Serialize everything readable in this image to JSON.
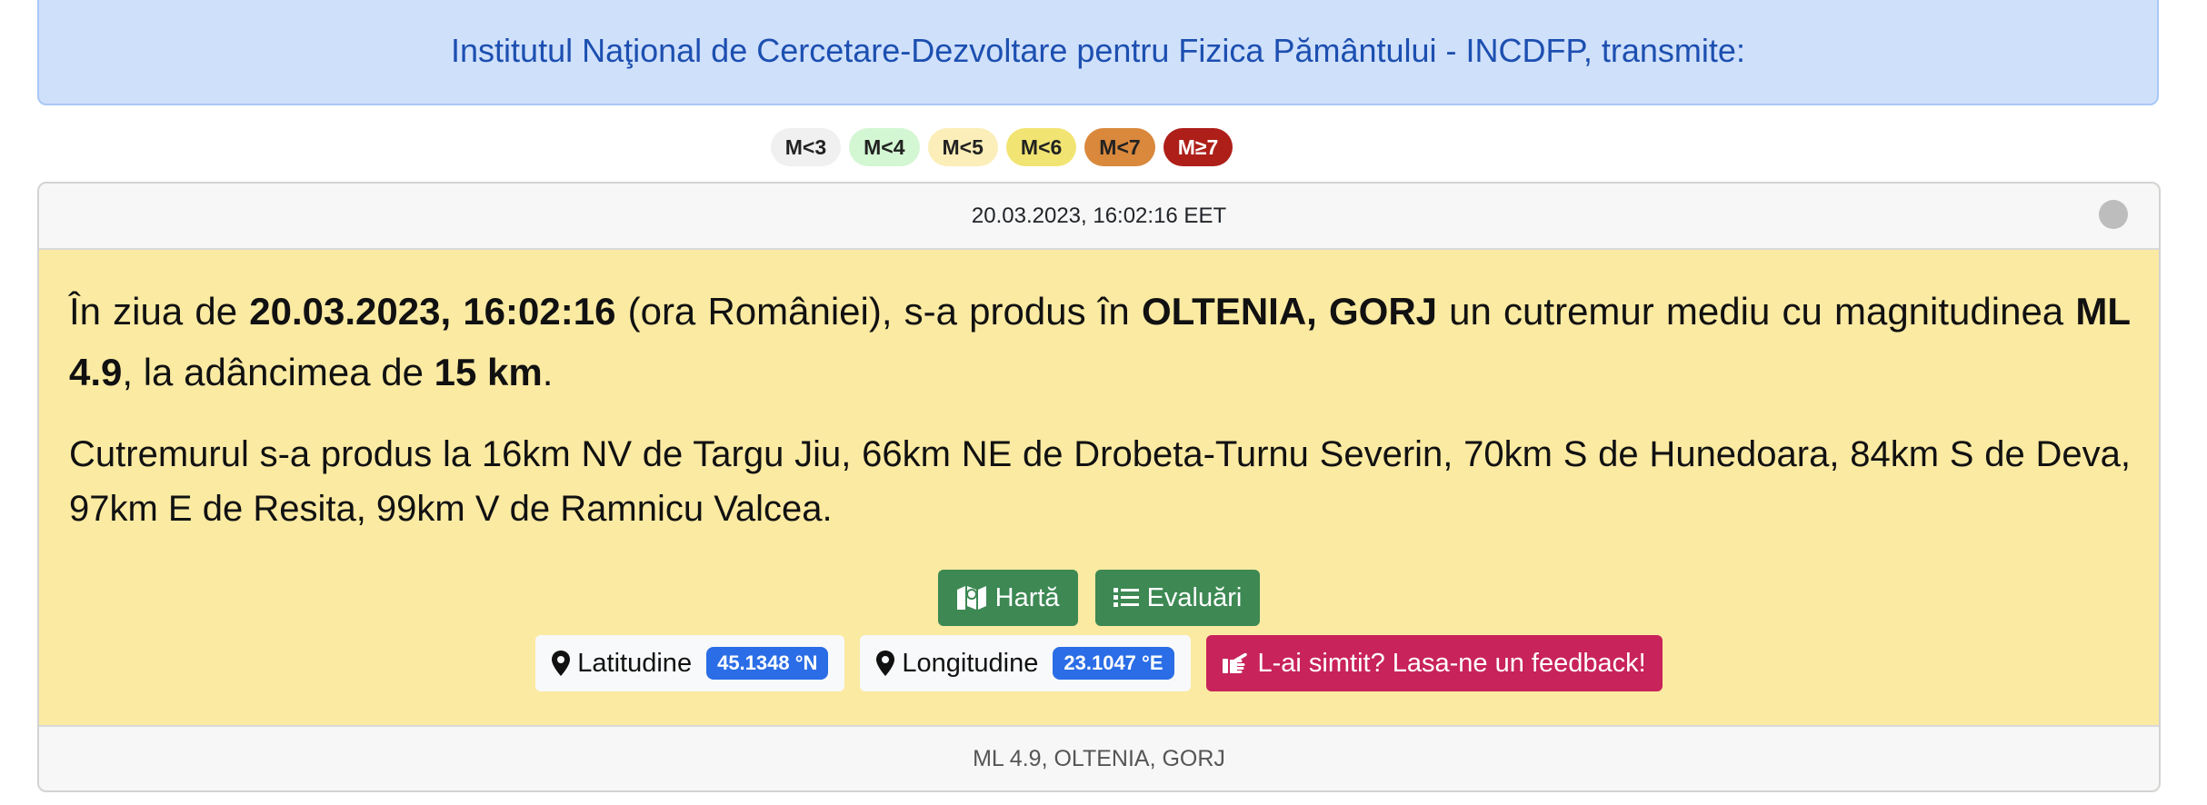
{
  "banner": {
    "text": "Institutul Naţional de Cercetare-Dezvoltare pentru Fizica Pământului - INCDFP, transmite:"
  },
  "legend": [
    {
      "label": "M<3",
      "color": "#f0f0f0"
    },
    {
      "label": "M<4",
      "color": "#d3f6d3"
    },
    {
      "label": "M<5",
      "color": "#fbeeb8"
    },
    {
      "label": "M<6",
      "color": "#f1e472"
    },
    {
      "label": "M<7",
      "color": "#d9883c"
    },
    {
      "label": "M≥7",
      "color": "#ae1f1a"
    }
  ],
  "card": {
    "header": "20.03.2023, 16:02:16 EET",
    "summary": {
      "t1": "În ziua de ",
      "datetime": "20.03.2023, 16:02:16",
      "t2": " (ora României), s-a produs în ",
      "region": "OLTENIA, GORJ",
      "t3": " un cutremur mediu cu magnitudinea ",
      "magnitude": "ML 4.9",
      "t4": ", la adâncimea de ",
      "depth": "15 km",
      "t5": "."
    },
    "distances": "Cutremurul s-a produs la 16km NV de Targu Jiu, 66km NE de Drobeta-Turnu Severin, 70km S de Hunedoara, 84km S de Deva, 97km E de Resita, 99km V de Ramnicu Valcea.",
    "buttons": {
      "map": "Hartă",
      "evaluations": "Evaluări"
    },
    "latitude": {
      "label": "Latitudine",
      "value": "45.1348 °N"
    },
    "longitude": {
      "label": "Longitudine",
      "value": "23.1047 °E"
    },
    "feedback": "L-ai simtit? Lasa-ne un feedback!",
    "footer": "ML 4.9, OLTENIA, GORJ"
  },
  "colors": {
    "background": "#fbeaa2",
    "accent": "#3d8853",
    "feedback": "#c8235a",
    "badge": "#2a6de6"
  }
}
